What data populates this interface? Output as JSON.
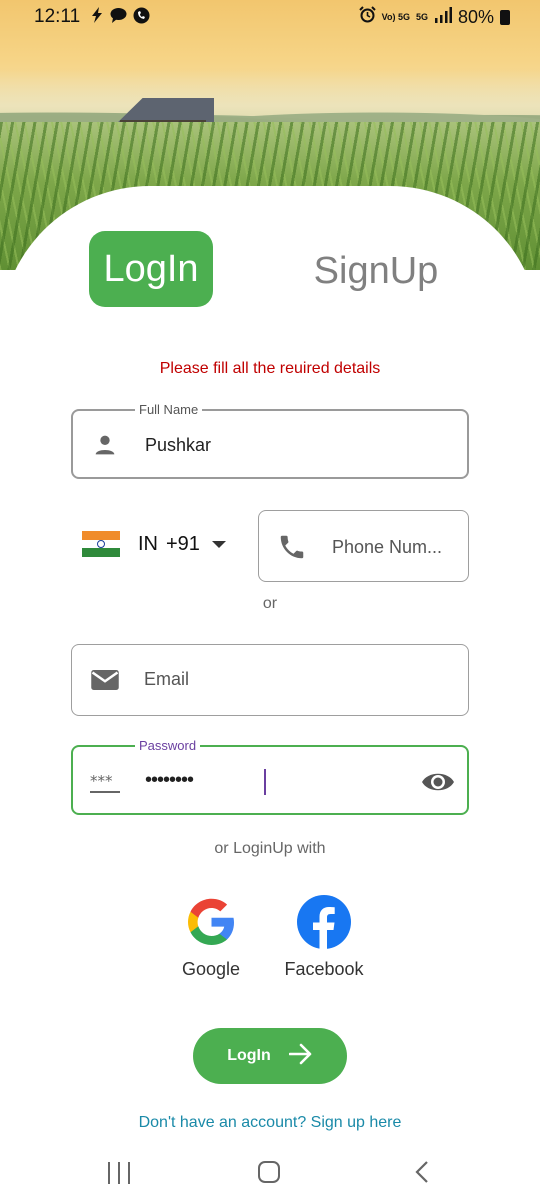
{
  "status_bar": {
    "time": "12:11",
    "notification_icons": [
      "flash-icon",
      "chat-icon",
      "call-icon"
    ],
    "volte_label": "Vo) 5G",
    "network_label": "5G",
    "battery_percent": "80%"
  },
  "tabs": {
    "login_label": "LogIn",
    "signup_label": "SignUp"
  },
  "form": {
    "error_message": "Please fill all the reuired details",
    "full_name": {
      "legend": "Full Name",
      "value": "Pushkar"
    },
    "country": {
      "code": "IN",
      "dial": "+91"
    },
    "phone": {
      "placeholder": "Phone Num..."
    },
    "or_text": "or",
    "email": {
      "placeholder": "Email"
    },
    "password": {
      "legend": "Password",
      "masked_value": "••••••••"
    },
    "or_login_text": "or LoginUp with"
  },
  "social": {
    "google_label": "Google",
    "facebook_label": "Facebook"
  },
  "login_button_label": "LogIn",
  "signup_prompt": "Don't have an account? Sign up here",
  "colors": {
    "accent_green": "#4caf50",
    "error_red": "#c00000",
    "link_teal": "#1a8aa8",
    "password_purple": "#6a3fa0"
  }
}
